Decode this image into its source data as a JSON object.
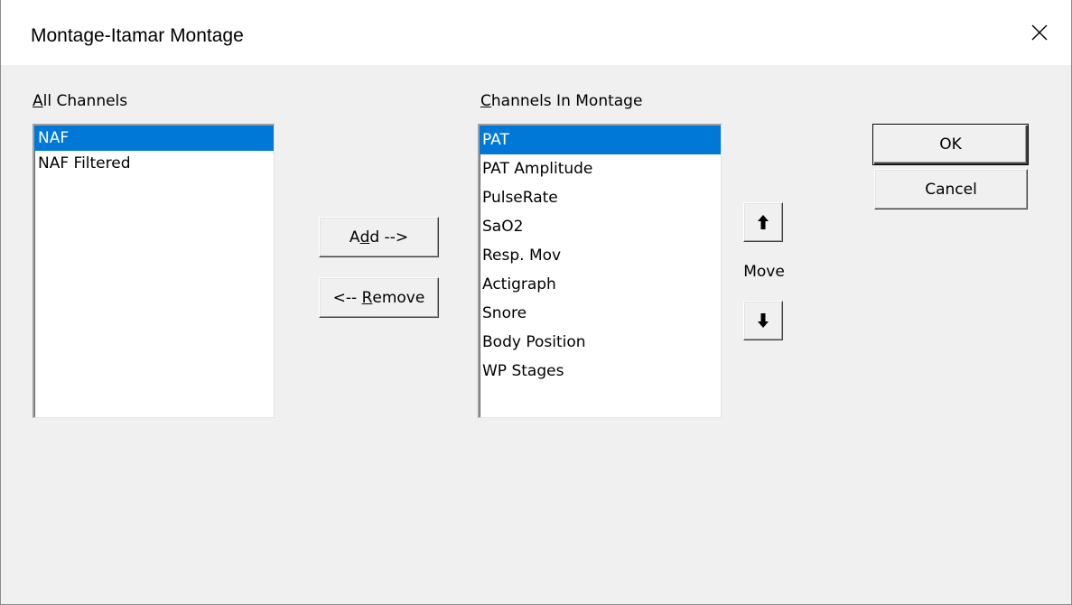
{
  "window": {
    "title": "Montage-Itamar Montage",
    "close_icon": "close-icon"
  },
  "all_channels": {
    "label_mnemonic": "A",
    "label_rest": "ll Channels",
    "items": [
      {
        "label": "NAF",
        "selected": true
      },
      {
        "label": "NAF Filtered",
        "selected": false
      }
    ]
  },
  "montage_channels": {
    "label_mnemonic": "C",
    "label_rest": "hannels In Montage",
    "items": [
      {
        "label": "PAT",
        "selected": true
      },
      {
        "label": "PAT Amplitude",
        "selected": false
      },
      {
        "label": "PulseRate",
        "selected": false
      },
      {
        "label": "SaO2",
        "selected": false
      },
      {
        "label": "Resp. Mov",
        "selected": false
      },
      {
        "label": "Actigraph",
        "selected": false
      },
      {
        "label": "Snore",
        "selected": false
      },
      {
        "label": "Body Position",
        "selected": false
      },
      {
        "label": "WP Stages",
        "selected": false
      }
    ]
  },
  "buttons": {
    "add_pre": "A",
    "add_mnemonic": "d",
    "add_post": "d -->",
    "remove_pre": "<-- ",
    "remove_mnemonic": "R",
    "remove_post": "emove",
    "ok": "OK",
    "cancel": "Cancel",
    "move_up_icon": "arrow-up-icon",
    "move_down_icon": "arrow-down-icon"
  },
  "move_label": "Move",
  "colors": {
    "selection": "#0078d7",
    "dialog_bg": "#f0f0f0"
  }
}
